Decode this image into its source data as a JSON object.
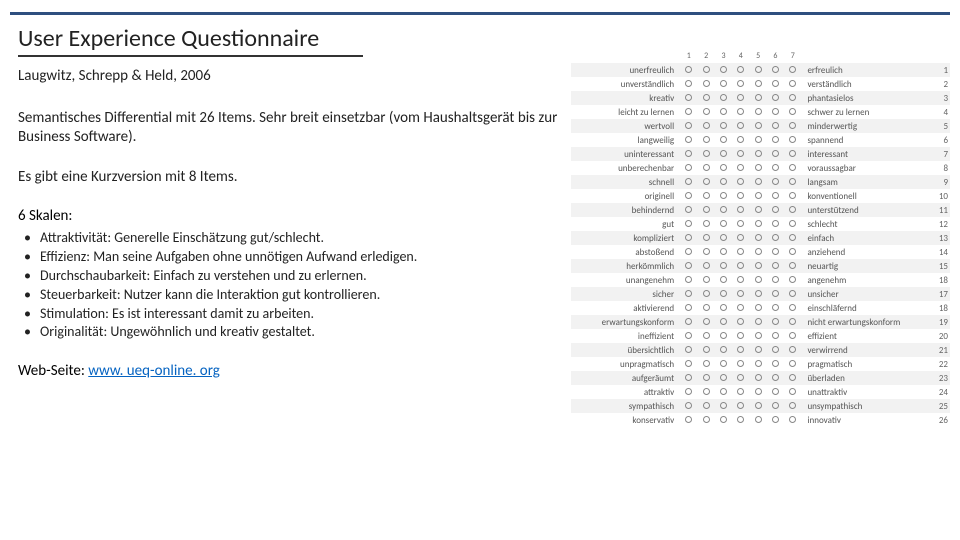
{
  "title": "User Experience Questionnaire",
  "authors": "Laugwitz, Schrepp & Held, 2006",
  "para1": "Semantisches Differential mit 26 Items. Sehr breit einsetzbar (vom Haushaltsgerät bis zur Business Software).",
  "para2": "Es gibt eine Kurzversion mit 8 Items.",
  "scales_head": "6 Skalen:",
  "scales": [
    "Attraktivität: Generelle Einschätzung gut/schlecht.",
    "Effizienz: Man seine Aufgaben ohne unnötigen Aufwand erledigen.",
    "Durchschaubarkeit: Einfach zu verstehen und zu erlernen.",
    "Steuerbarkeit: Nutzer kann die Interaktion gut kontrollieren.",
    "Stimulation: Es ist interessant damit zu arbeiten.",
    "Originalität: Ungewöhnlich und kreativ gestaltet."
  ],
  "web_label": "Web-Seite: ",
  "web_link": "www. ueq-online. org",
  "scale_numbers": [
    "1",
    "2",
    "3",
    "4",
    "5",
    "6",
    "7"
  ],
  "items": [
    {
      "l": "unerfreulich",
      "r": "erfreulich",
      "n": "1",
      "shade": true
    },
    {
      "l": "unverständlich",
      "r": "verständlich",
      "n": "2",
      "shade": false
    },
    {
      "l": "kreativ",
      "r": "phantasielos",
      "n": "3",
      "shade": true
    },
    {
      "l": "leicht zu lernen",
      "r": "schwer zu lernen",
      "n": "4",
      "shade": false
    },
    {
      "l": "wertvoll",
      "r": "minderwertig",
      "n": "5",
      "shade": true
    },
    {
      "l": "langweilig",
      "r": "spannend",
      "n": "6",
      "shade": false
    },
    {
      "l": "uninteressant",
      "r": "interessant",
      "n": "7",
      "shade": true
    },
    {
      "l": "unberechenbar",
      "r": "voraussagbar",
      "n": "8",
      "shade": false
    },
    {
      "l": "schnell",
      "r": "langsam",
      "n": "9",
      "shade": true
    },
    {
      "l": "originell",
      "r": "konventionell",
      "n": "10",
      "shade": false
    },
    {
      "l": "behindernd",
      "r": "unterstützend",
      "n": "11",
      "shade": true
    },
    {
      "l": "gut",
      "r": "schlecht",
      "n": "12",
      "shade": false
    },
    {
      "l": "kompliziert",
      "r": "einfach",
      "n": "13",
      "shade": true
    },
    {
      "l": "abstoßend",
      "r": "anziehend",
      "n": "14",
      "shade": false
    },
    {
      "l": "herkömmlich",
      "r": "neuartig",
      "n": "15",
      "shade": true
    },
    {
      "l": "unangenehm",
      "r": "angenehm",
      "n": "18",
      "shade": false
    },
    {
      "l": "sicher",
      "r": "unsicher",
      "n": "17",
      "shade": true
    },
    {
      "l": "aktivierend",
      "r": "einschläfernd",
      "n": "18",
      "shade": false
    },
    {
      "l": "erwartungskonform",
      "r": "nicht erwartungskonform",
      "n": "19",
      "shade": true
    },
    {
      "l": "ineffizient",
      "r": "effizient",
      "n": "20",
      "shade": false
    },
    {
      "l": "übersichtlich",
      "r": "verwirrend",
      "n": "21",
      "shade": true
    },
    {
      "l": "unpragmatisch",
      "r": "pragmatisch",
      "n": "22",
      "shade": false
    },
    {
      "l": "aufgeräumt",
      "r": "überladen",
      "n": "23",
      "shade": true
    },
    {
      "l": "attraktiv",
      "r": "unattraktiv",
      "n": "24",
      "shade": false
    },
    {
      "l": "sympathisch",
      "r": "unsympathisch",
      "n": "25",
      "shade": true
    },
    {
      "l": "konservativ",
      "r": "innovativ",
      "n": "26",
      "shade": false
    }
  ]
}
